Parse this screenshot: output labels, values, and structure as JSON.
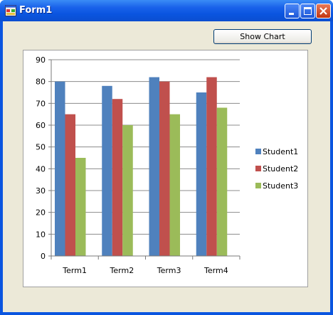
{
  "window": {
    "title": "Form1"
  },
  "toolbar": {
    "show_chart_label": "Show Chart"
  },
  "chart_data": {
    "type": "bar",
    "categories": [
      "Term1",
      "Term2",
      "Term3",
      "Term4"
    ],
    "series": [
      {
        "name": "Student1",
        "values": [
          80,
          78,
          82,
          75
        ],
        "color": "#4f81bd"
      },
      {
        "name": "Student2",
        "values": [
          65,
          72,
          80,
          82
        ],
        "color": "#c0504d"
      },
      {
        "name": "Student3",
        "values": [
          45,
          60,
          65,
          68
        ],
        "color": "#9bbb59"
      }
    ],
    "ylim": [
      0,
      90
    ],
    "yticks": [
      0,
      10,
      20,
      30,
      40,
      50,
      60,
      70,
      80,
      90
    ],
    "grid": true,
    "legend": "right"
  }
}
